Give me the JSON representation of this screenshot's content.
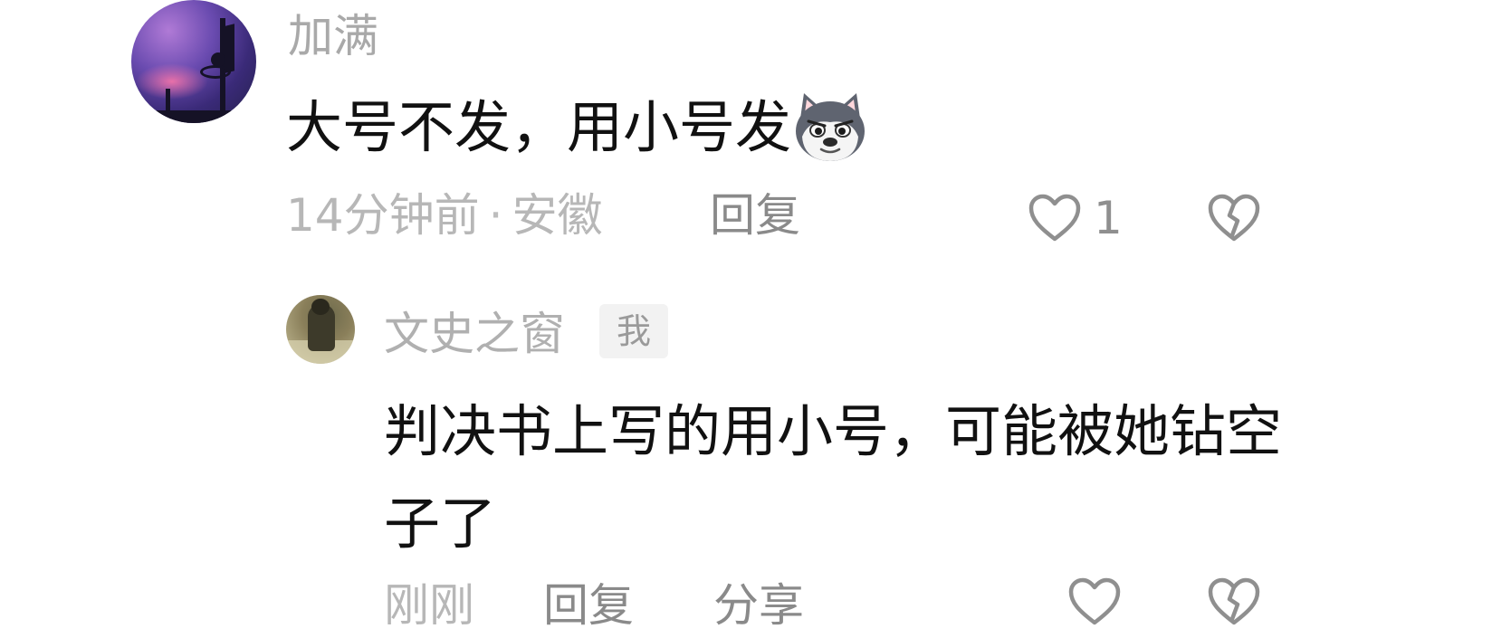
{
  "comment": {
    "username": "加满",
    "text": "大号不发，用小号发",
    "emoji": "dog-emoji",
    "time": "14分钟前",
    "separator": "·",
    "location": "安徽",
    "reply_label": "回复",
    "like_count": "1",
    "icons": {
      "like": "heart-outline-icon",
      "dislike": "broken-heart-icon"
    }
  },
  "reply": {
    "username": "文史之窗",
    "badge": "我",
    "text": "判决书上写的用小号，可能被她钻空子了",
    "time": "刚刚",
    "reply_label": "回复",
    "share_label": "分享",
    "icons": {
      "like": "heart-outline-icon",
      "dislike": "broken-heart-icon"
    }
  },
  "colors": {
    "text_primary": "#111111",
    "text_muted": "#b7b7b7",
    "action": "#8a8a8a",
    "badge_bg": "#f2f2f2"
  }
}
